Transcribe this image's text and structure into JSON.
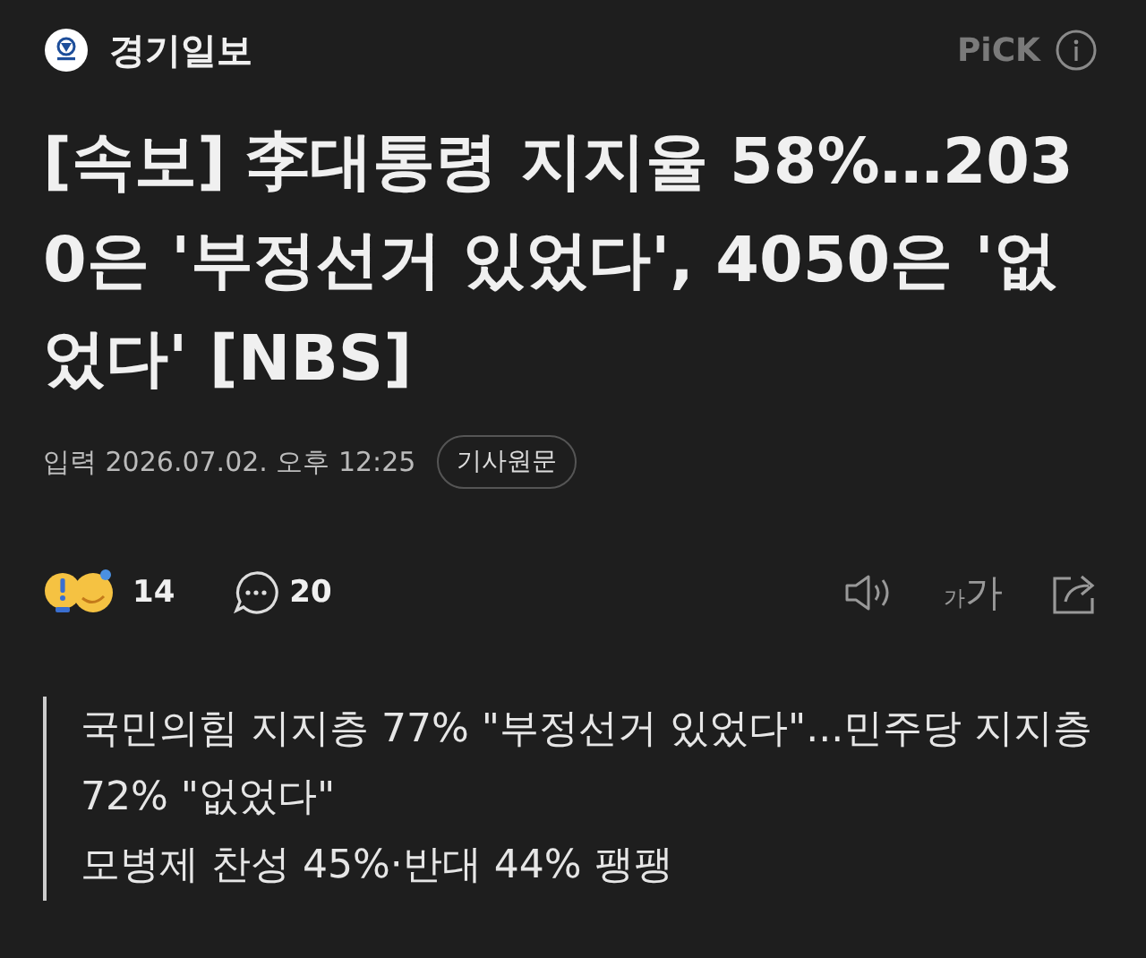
{
  "header": {
    "publisher": "경기일보",
    "pick_label": "PiCK"
  },
  "headline": "[속보] 李대통령 지지율 58%…2030은 '부정선거 있었다', 4050은 '없었다' [NBS]",
  "meta": {
    "date": "입력 2026.07.02. 오후 12:25",
    "original_button": "기사원문"
  },
  "actions": {
    "reactions_count": "14",
    "comments_count": "20",
    "font_size_small": "가",
    "font_size_large": "가"
  },
  "subtitle": [
    "국민의힘 지지층 77% \"부정선거 있었다\"...민주당 지지층 72% \"없었다\"",
    "모병제 찬성 45%·반대 44% 팽팽"
  ]
}
